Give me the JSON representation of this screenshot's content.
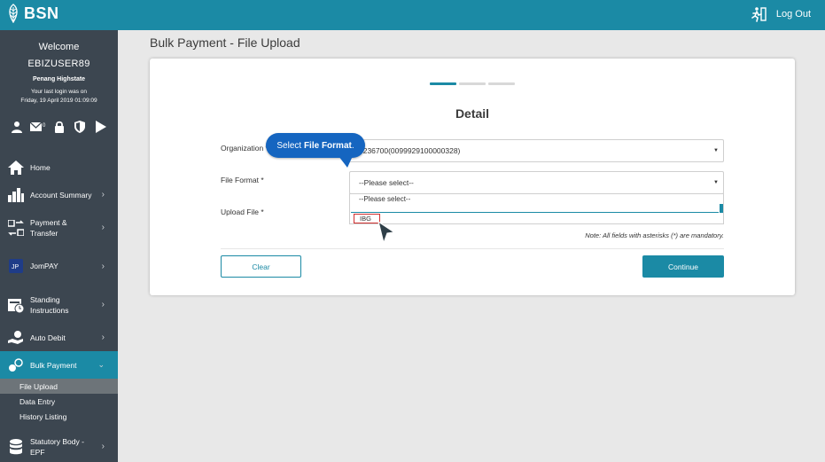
{
  "header": {
    "brand": "BSN",
    "logout_label": "Log Out"
  },
  "sidebar": {
    "welcome": "Welcome",
    "username": "EBIZUSER89",
    "branch": "Penang Highstate",
    "last_login_label": "Your last login was on",
    "last_login_time": "Friday, 19 April 2019 01:09:09",
    "mail_count": "0",
    "nav": [
      {
        "label": "Home"
      },
      {
        "label": "Account Summary"
      },
      {
        "label_line1": "Payment &",
        "label_line2": "Transfer"
      },
      {
        "label": "JomPAY"
      },
      {
        "label_line1": "Standing",
        "label_line2": "Instructions"
      },
      {
        "label": "Auto Debit"
      },
      {
        "label": "Bulk Payment"
      },
      {
        "label_line1": "Statutory Body -",
        "label_line2": "EPF"
      }
    ],
    "bulk_sub": [
      "File Upload",
      "Data Entry",
      "History Listing"
    ]
  },
  "main": {
    "page_title": "Bulk Payment - File Upload",
    "section_title": "Detail",
    "fields": {
      "organization_label": "Organization *",
      "organization_value": "6236700(0099929100000328)",
      "file_format_label": "File Format *",
      "file_format_value": "--Please select--",
      "upload_file_label": "Upload File *"
    },
    "dropdown_options": [
      "--Please select--",
      "IBG"
    ],
    "note": "Note: All fields with asterisks (*) are mandatory.",
    "buttons": {
      "clear": "Clear",
      "continue": "Continue"
    }
  },
  "tooltip": {
    "prefix": "Select ",
    "emphasis": "File Format",
    "suffix": "."
  },
  "colors": {
    "brand": "#1b8aa5",
    "sidebar_bg": "#3c4650",
    "tooltip_bg": "#1565c0",
    "highlight_border": "#d03030"
  }
}
